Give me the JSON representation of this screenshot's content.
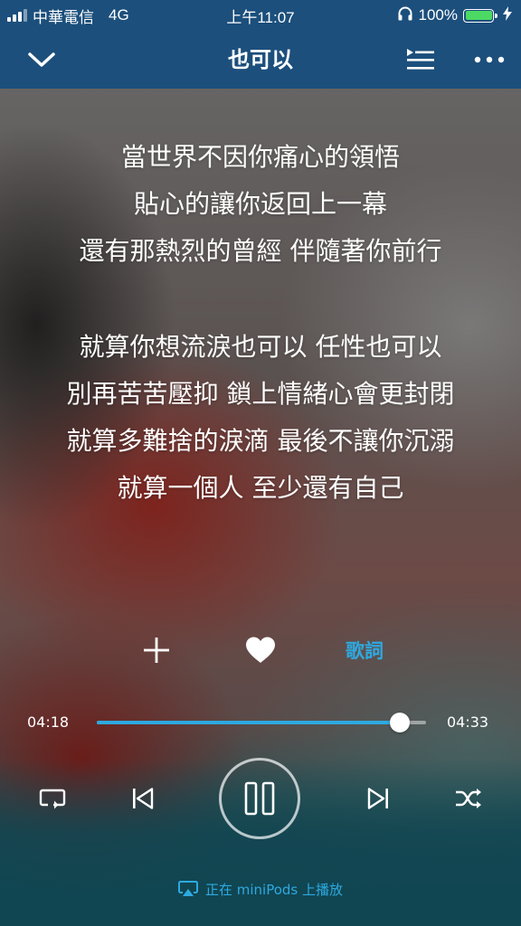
{
  "status_bar": {
    "carrier": "中華電信",
    "network": "4G",
    "time": "上午11:07",
    "battery_percent": "100%",
    "battery_level": 1.0,
    "battery_color": "#4cd964",
    "signal_bars": 3,
    "headphones_icon": "headphones-icon",
    "charging_icon": "bolt-icon"
  },
  "nav": {
    "title": "也可以",
    "back_icon": "chevron-down-icon",
    "queue_icon": "playlist-icon",
    "more_icon": "more-icon"
  },
  "lyrics": {
    "groups": [
      [
        "當世界不因你痛心的領悟",
        "貼心的讓你返回上一幕",
        "還有那熱烈的曾經 伴隨著你前行"
      ],
      [
        "就算你想流淚也可以 任性也可以",
        "別再苦苦壓抑 鎖上情緒心會更封閉",
        "就算多難捨的淚滴 最後不讓你沉溺",
        "就算一個人 至少還有自己"
      ]
    ]
  },
  "actions": {
    "add_icon": "plus-icon",
    "like_icon": "heart-icon",
    "lyrics_label": "歌詞"
  },
  "playback": {
    "elapsed": "04:18",
    "total": "04:33",
    "progress": 0.92,
    "accent_color": "#2ea9e0"
  },
  "controls": {
    "repeat_icon": "repeat-icon",
    "prev_icon": "previous-icon",
    "play_pause_icon": "pause-icon",
    "next_icon": "next-icon",
    "shuffle_icon": "shuffle-icon"
  },
  "airplay": {
    "icon": "airplay-icon",
    "label": "正在 miniPods 上播放"
  },
  "colors": {
    "header": "#1c4f7c",
    "accent": "#2ea9e0"
  }
}
